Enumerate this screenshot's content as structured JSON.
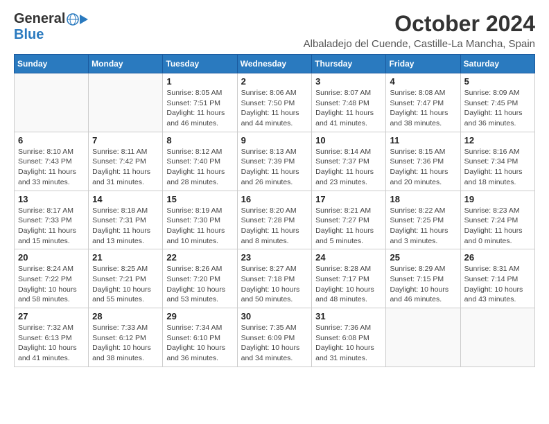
{
  "logo": {
    "general": "General",
    "blue": "Blue"
  },
  "title": "October 2024",
  "location": "Albaladejo del Cuende, Castille-La Mancha, Spain",
  "weekdays": [
    "Sunday",
    "Monday",
    "Tuesday",
    "Wednesday",
    "Thursday",
    "Friday",
    "Saturday"
  ],
  "weeks": [
    [
      {
        "day": "",
        "info": ""
      },
      {
        "day": "",
        "info": ""
      },
      {
        "day": "1",
        "info": "Sunrise: 8:05 AM\nSunset: 7:51 PM\nDaylight: 11 hours and 46 minutes."
      },
      {
        "day": "2",
        "info": "Sunrise: 8:06 AM\nSunset: 7:50 PM\nDaylight: 11 hours and 44 minutes."
      },
      {
        "day": "3",
        "info": "Sunrise: 8:07 AM\nSunset: 7:48 PM\nDaylight: 11 hours and 41 minutes."
      },
      {
        "day": "4",
        "info": "Sunrise: 8:08 AM\nSunset: 7:47 PM\nDaylight: 11 hours and 38 minutes."
      },
      {
        "day": "5",
        "info": "Sunrise: 8:09 AM\nSunset: 7:45 PM\nDaylight: 11 hours and 36 minutes."
      }
    ],
    [
      {
        "day": "6",
        "info": "Sunrise: 8:10 AM\nSunset: 7:43 PM\nDaylight: 11 hours and 33 minutes."
      },
      {
        "day": "7",
        "info": "Sunrise: 8:11 AM\nSunset: 7:42 PM\nDaylight: 11 hours and 31 minutes."
      },
      {
        "day": "8",
        "info": "Sunrise: 8:12 AM\nSunset: 7:40 PM\nDaylight: 11 hours and 28 minutes."
      },
      {
        "day": "9",
        "info": "Sunrise: 8:13 AM\nSunset: 7:39 PM\nDaylight: 11 hours and 26 minutes."
      },
      {
        "day": "10",
        "info": "Sunrise: 8:14 AM\nSunset: 7:37 PM\nDaylight: 11 hours and 23 minutes."
      },
      {
        "day": "11",
        "info": "Sunrise: 8:15 AM\nSunset: 7:36 PM\nDaylight: 11 hours and 20 minutes."
      },
      {
        "day": "12",
        "info": "Sunrise: 8:16 AM\nSunset: 7:34 PM\nDaylight: 11 hours and 18 minutes."
      }
    ],
    [
      {
        "day": "13",
        "info": "Sunrise: 8:17 AM\nSunset: 7:33 PM\nDaylight: 11 hours and 15 minutes."
      },
      {
        "day": "14",
        "info": "Sunrise: 8:18 AM\nSunset: 7:31 PM\nDaylight: 11 hours and 13 minutes."
      },
      {
        "day": "15",
        "info": "Sunrise: 8:19 AM\nSunset: 7:30 PM\nDaylight: 11 hours and 10 minutes."
      },
      {
        "day": "16",
        "info": "Sunrise: 8:20 AM\nSunset: 7:28 PM\nDaylight: 11 hours and 8 minutes."
      },
      {
        "day": "17",
        "info": "Sunrise: 8:21 AM\nSunset: 7:27 PM\nDaylight: 11 hours and 5 minutes."
      },
      {
        "day": "18",
        "info": "Sunrise: 8:22 AM\nSunset: 7:25 PM\nDaylight: 11 hours and 3 minutes."
      },
      {
        "day": "19",
        "info": "Sunrise: 8:23 AM\nSunset: 7:24 PM\nDaylight: 11 hours and 0 minutes."
      }
    ],
    [
      {
        "day": "20",
        "info": "Sunrise: 8:24 AM\nSunset: 7:22 PM\nDaylight: 10 hours and 58 minutes."
      },
      {
        "day": "21",
        "info": "Sunrise: 8:25 AM\nSunset: 7:21 PM\nDaylight: 10 hours and 55 minutes."
      },
      {
        "day": "22",
        "info": "Sunrise: 8:26 AM\nSunset: 7:20 PM\nDaylight: 10 hours and 53 minutes."
      },
      {
        "day": "23",
        "info": "Sunrise: 8:27 AM\nSunset: 7:18 PM\nDaylight: 10 hours and 50 minutes."
      },
      {
        "day": "24",
        "info": "Sunrise: 8:28 AM\nSunset: 7:17 PM\nDaylight: 10 hours and 48 minutes."
      },
      {
        "day": "25",
        "info": "Sunrise: 8:29 AM\nSunset: 7:15 PM\nDaylight: 10 hours and 46 minutes."
      },
      {
        "day": "26",
        "info": "Sunrise: 8:31 AM\nSunset: 7:14 PM\nDaylight: 10 hours and 43 minutes."
      }
    ],
    [
      {
        "day": "27",
        "info": "Sunrise: 7:32 AM\nSunset: 6:13 PM\nDaylight: 10 hours and 41 minutes."
      },
      {
        "day": "28",
        "info": "Sunrise: 7:33 AM\nSunset: 6:12 PM\nDaylight: 10 hours and 38 minutes."
      },
      {
        "day": "29",
        "info": "Sunrise: 7:34 AM\nSunset: 6:10 PM\nDaylight: 10 hours and 36 minutes."
      },
      {
        "day": "30",
        "info": "Sunrise: 7:35 AM\nSunset: 6:09 PM\nDaylight: 10 hours and 34 minutes."
      },
      {
        "day": "31",
        "info": "Sunrise: 7:36 AM\nSunset: 6:08 PM\nDaylight: 10 hours and 31 minutes."
      },
      {
        "day": "",
        "info": ""
      },
      {
        "day": "",
        "info": ""
      }
    ]
  ]
}
